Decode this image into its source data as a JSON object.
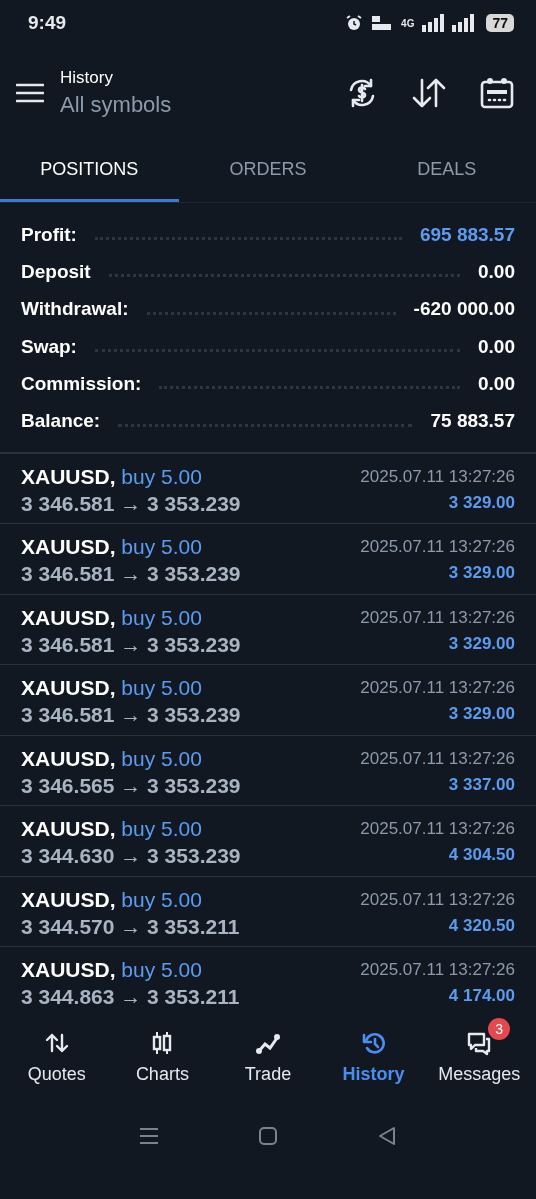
{
  "status_bar": {
    "time": "9:49",
    "network": "4G",
    "battery": "77"
  },
  "header": {
    "title": "History",
    "subtitle": "All symbols"
  },
  "tabs": [
    {
      "label": "POSITIONS",
      "selected": true
    },
    {
      "label": "ORDERS",
      "selected": false
    },
    {
      "label": "DEALS",
      "selected": false
    }
  ],
  "summary": [
    {
      "label": "Profit:",
      "value": "695 883.57",
      "accent": true
    },
    {
      "label": "Deposit",
      "value": "0.00",
      "accent": false
    },
    {
      "label": "Withdrawal:",
      "value": "-620 000.00",
      "accent": false
    },
    {
      "label": "Swap:",
      "value": "0.00",
      "accent": false
    },
    {
      "label": "Commission:",
      "value": "0.00",
      "accent": false
    },
    {
      "label": "Balance:",
      "value": "75 883.57",
      "accent": false
    }
  ],
  "trades": [
    {
      "symbol": "XAUUSD,",
      "side": "buy 5.00",
      "prices": "3 346.581 → 3 353.239",
      "time": "2025.07.11 13:27:26",
      "profit": "3 329.00"
    },
    {
      "symbol": "XAUUSD,",
      "side": "buy 5.00",
      "prices": "3 346.581 → 3 353.239",
      "time": "2025.07.11 13:27:26",
      "profit": "3 329.00"
    },
    {
      "symbol": "XAUUSD,",
      "side": "buy 5.00",
      "prices": "3 346.581 → 3 353.239",
      "time": "2025.07.11 13:27:26",
      "profit": "3 329.00"
    },
    {
      "symbol": "XAUUSD,",
      "side": "buy 5.00",
      "prices": "3 346.581 → 3 353.239",
      "time": "2025.07.11 13:27:26",
      "profit": "3 329.00"
    },
    {
      "symbol": "XAUUSD,",
      "side": "buy 5.00",
      "prices": "3 346.565 → 3 353.239",
      "time": "2025.07.11 13:27:26",
      "profit": "3 337.00"
    },
    {
      "symbol": "XAUUSD,",
      "side": "buy 5.00",
      "prices": "3 344.630 → 3 353.239",
      "time": "2025.07.11 13:27:26",
      "profit": "4 304.50"
    },
    {
      "symbol": "XAUUSD,",
      "side": "buy 5.00",
      "prices": "3 344.570 → 3 353.211",
      "time": "2025.07.11 13:27:26",
      "profit": "4 320.50"
    },
    {
      "symbol": "XAUUSD,",
      "side": "buy 5.00",
      "prices": "3 344.863 → 3 353.211",
      "time": "2025.07.11 13:27:26",
      "profit": "4 174.00"
    }
  ],
  "bottom_nav": [
    {
      "kind": "quotes",
      "label": "Quotes",
      "selected": false
    },
    {
      "kind": "charts",
      "label": "Charts",
      "selected": false
    },
    {
      "kind": "trade",
      "label": "Trade",
      "selected": false
    },
    {
      "kind": "history",
      "label": "History",
      "selected": true
    },
    {
      "kind": "messages",
      "label": "Messages",
      "selected": false,
      "badge": "3"
    }
  ]
}
